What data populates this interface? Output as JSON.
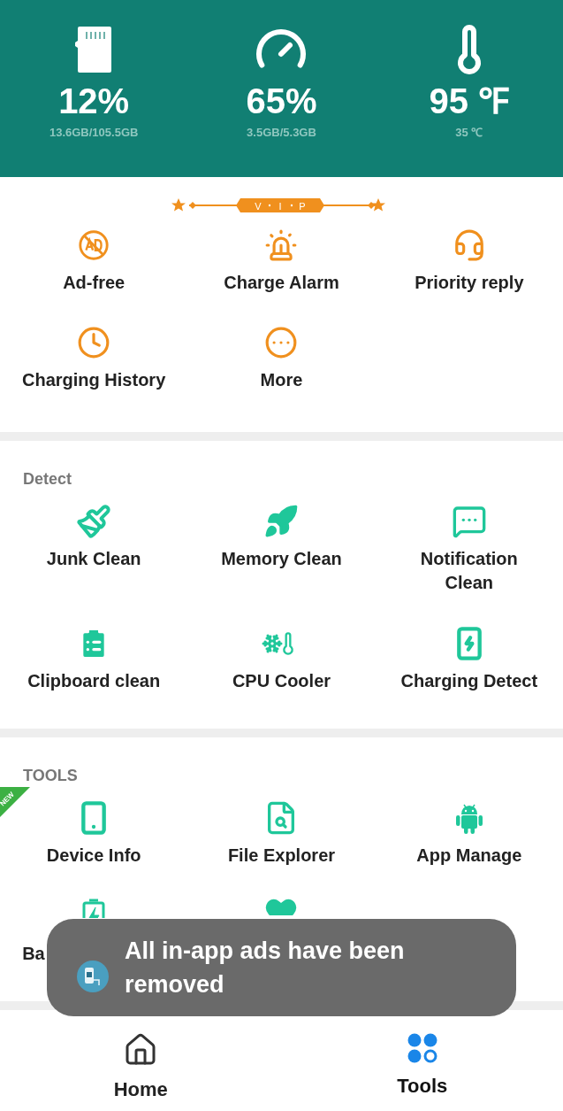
{
  "stats": [
    {
      "value": "12%",
      "detail": "13.6GB/105.5GB"
    },
    {
      "value": "65%",
      "detail": "3.5GB/5.3GB"
    },
    {
      "value": "95 ℉",
      "detail": "35 ℃"
    }
  ],
  "vip": {
    "letters": [
      "V",
      "I",
      "P"
    ]
  },
  "premium": {
    "items": [
      {
        "label": "Ad-free"
      },
      {
        "label": "Charge Alarm"
      },
      {
        "label": "Priority reply"
      },
      {
        "label": "Charging History"
      },
      {
        "label": "More"
      }
    ]
  },
  "sections": [
    {
      "title": "Detect",
      "items": [
        {
          "label": "Junk Clean"
        },
        {
          "label": "Memory Clean"
        },
        {
          "label": "Notification Clean"
        },
        {
          "label": "Clipboard clean"
        },
        {
          "label": "CPU Cooler"
        },
        {
          "label": "Charging Detect"
        }
      ]
    },
    {
      "title": "TOOLS",
      "items": [
        {
          "label": "Device Info",
          "badge": "NEW"
        },
        {
          "label": "File Explorer"
        },
        {
          "label": "App Manage"
        },
        {
          "label": "Ba",
          "covered": true
        },
        {
          "covered": true
        }
      ]
    }
  ],
  "toast": {
    "text": "All in-app ads have been removed"
  },
  "nav": [
    {
      "label": "Home",
      "selected": false
    },
    {
      "label": "Tools",
      "selected": true
    }
  ]
}
